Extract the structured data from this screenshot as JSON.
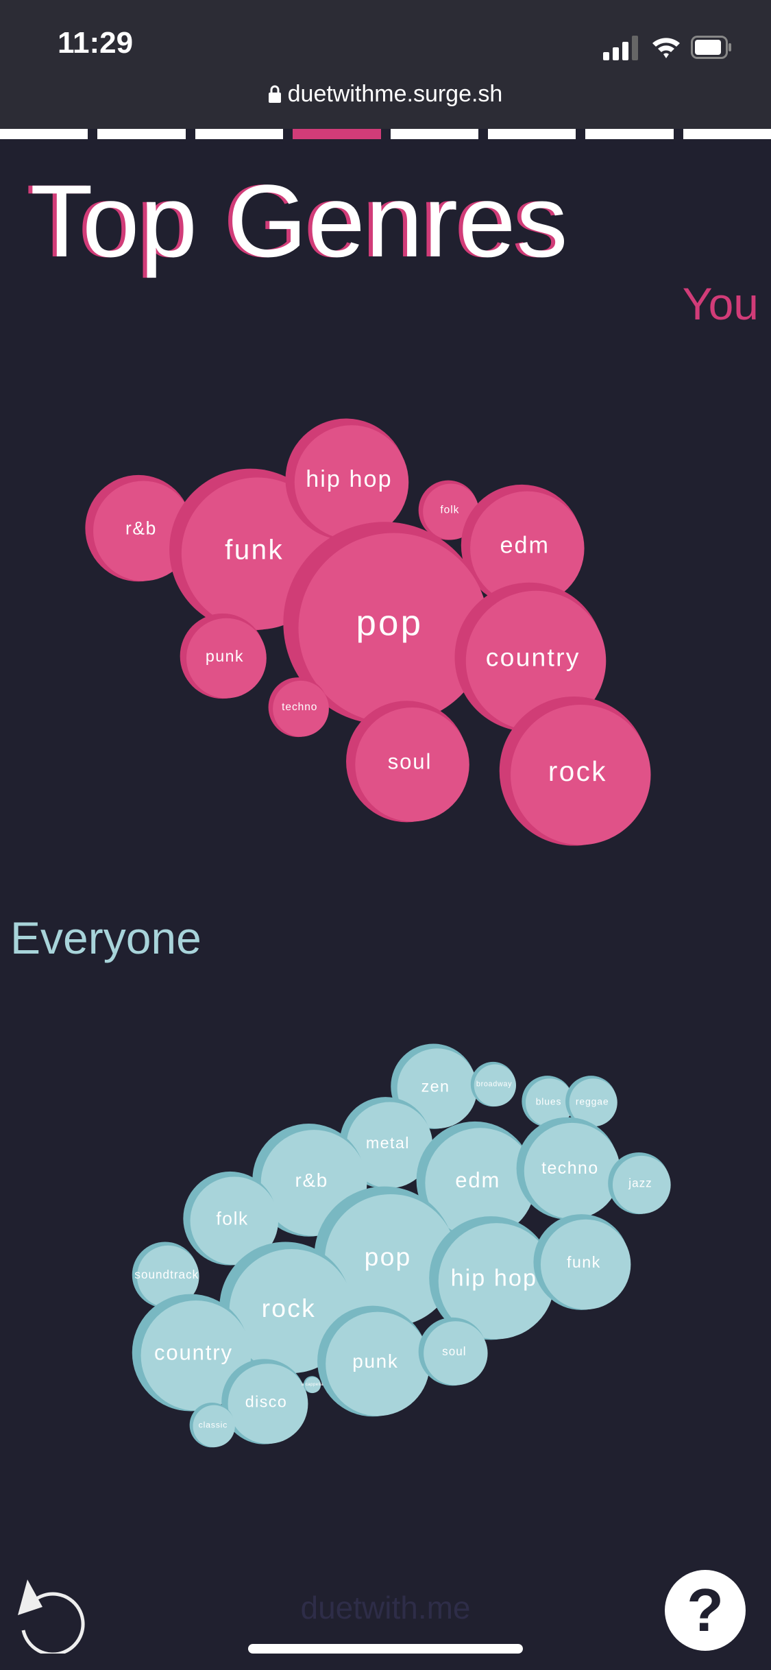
{
  "status_bar": {
    "time": "11:29",
    "url": "duetwithme.surge.sh"
  },
  "progress": {
    "total_steps": 8,
    "current_step": 4
  },
  "title": "Top Genres",
  "you": {
    "label": "You",
    "color": "#e05288",
    "shade": "#d03d76",
    "genres": [
      "r&b",
      "funk",
      "hip hop",
      "folk",
      "edm",
      "pop",
      "punk",
      "country",
      "techno",
      "soul",
      "rock"
    ]
  },
  "everyone": {
    "label": "Everyone",
    "color": "#a8d4da",
    "shade": "#79b8c2",
    "genres": [
      "zen",
      "broadway",
      "blues",
      "reggae",
      "metal",
      "r&b",
      "edm",
      "techno",
      "jazz",
      "folk",
      "pop",
      "hip hop",
      "funk",
      "soundtrack",
      "rock",
      "country",
      "punk",
      "soul",
      "disco",
      "classic",
      "a cappella"
    ]
  },
  "footer": {
    "brand": "duetwith.me",
    "help_label": "?"
  }
}
